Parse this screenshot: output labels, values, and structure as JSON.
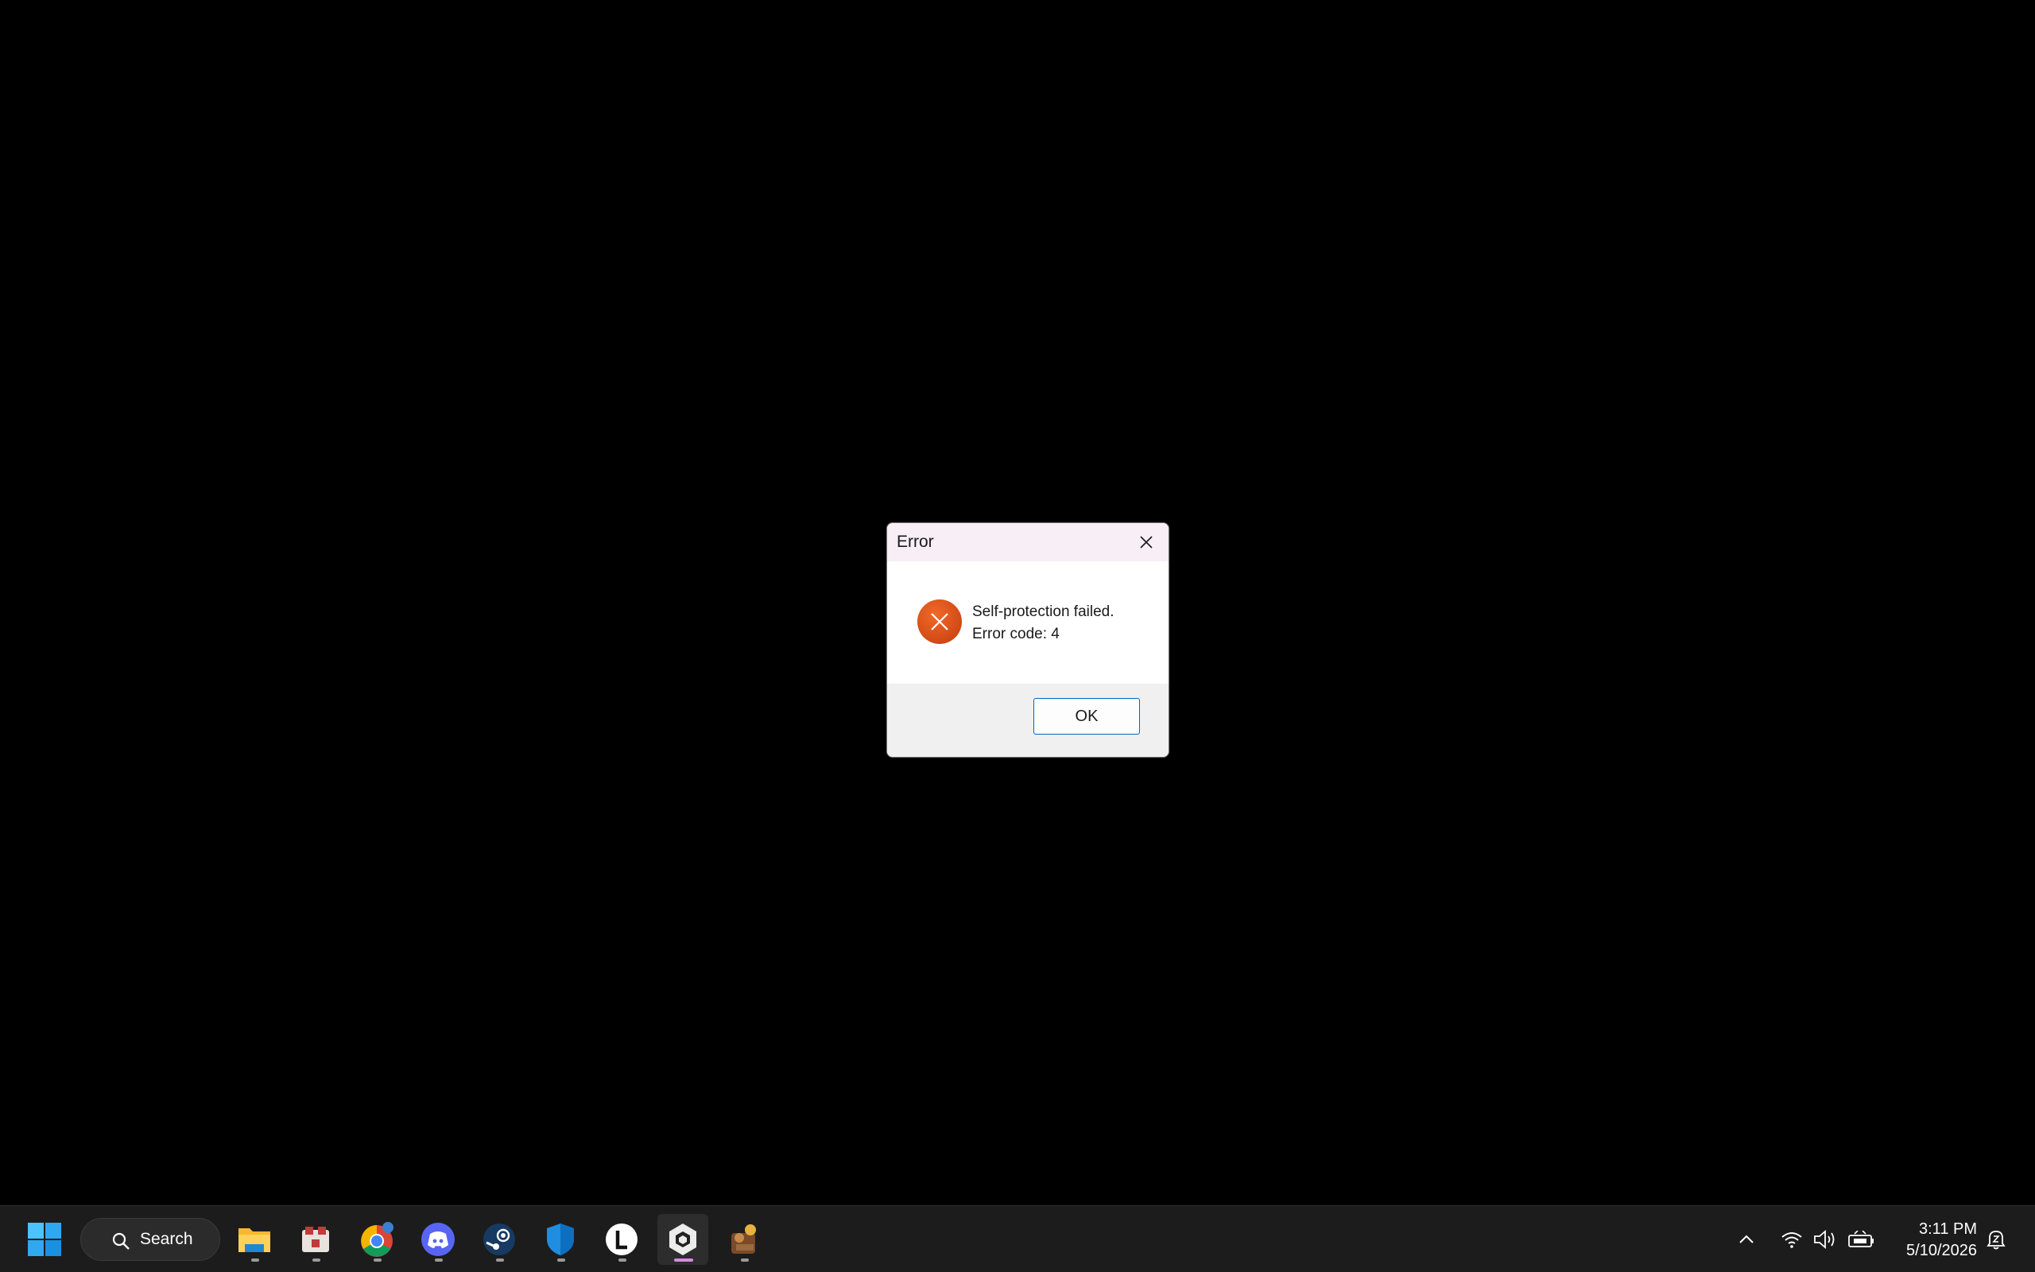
{
  "dialog": {
    "title": "Error",
    "message_line1": "Self-protection failed.",
    "message_line2": "Error code: 4",
    "ok_label": "OK",
    "icon": "error-icon"
  },
  "taskbar": {
    "search_label": "Search",
    "apps": [
      {
        "name": "start-button",
        "icon": "windows-logo-icon"
      },
      {
        "name": "file-explorer",
        "icon": "folder-icon"
      },
      {
        "name": "app-store-like",
        "icon": "game-app-icon"
      },
      {
        "name": "chrome",
        "icon": "chrome-icon"
      },
      {
        "name": "discord",
        "icon": "discord-icon"
      },
      {
        "name": "steam",
        "icon": "steam-icon"
      },
      {
        "name": "security",
        "icon": "shield-icon"
      },
      {
        "name": "l-app",
        "icon": "l-letter-icon"
      },
      {
        "name": "unity",
        "icon": "unity-icon"
      },
      {
        "name": "game",
        "icon": "game-character-icon"
      }
    ],
    "time": "3:11 PM",
    "date": "5/10/2026"
  },
  "colors": {
    "accent": "#0067c0",
    "error": "#d9480f",
    "active_indicator": "#d58ce0"
  }
}
